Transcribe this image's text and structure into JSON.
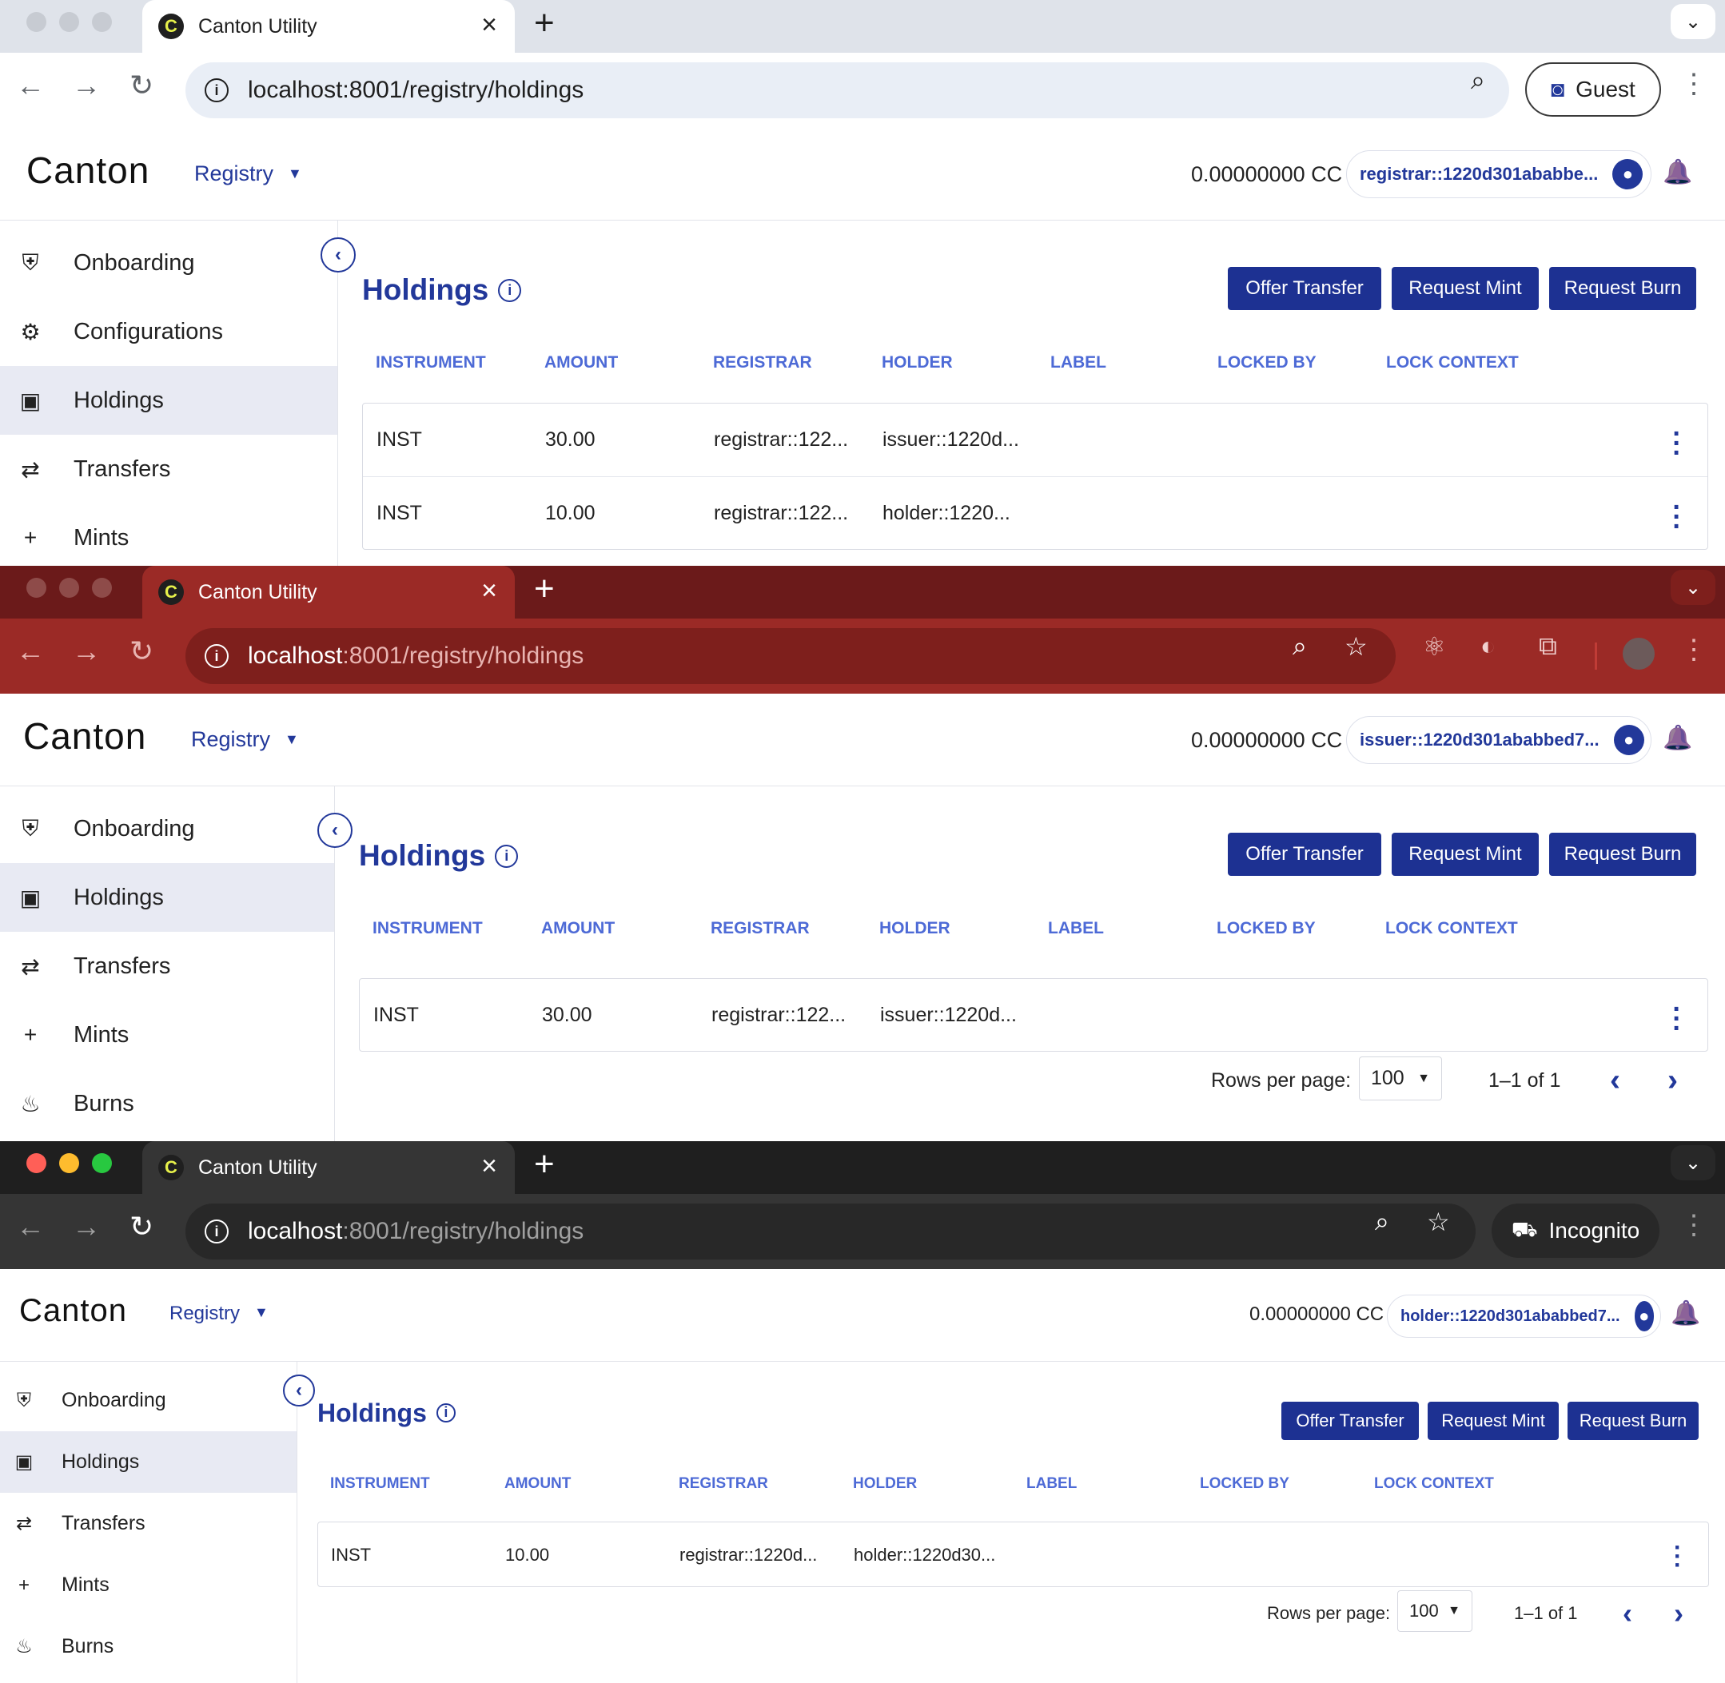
{
  "windows": [
    {
      "theme": "light",
      "tab_title": "Canton Utility",
      "url_host": "localhost",
      "url_path": ":8001/registry/holdings",
      "profile_label": "Guest",
      "app": {
        "logo": "Canton",
        "menu_label": "Registry",
        "balance": "0.00000000 CC",
        "party": "registrar::1220d301ababbe...",
        "sidebar": [
          {
            "icon": "shield-icon",
            "label": "Onboarding",
            "active": false
          },
          {
            "icon": "gear-icon",
            "label": "Configurations",
            "active": false
          },
          {
            "icon": "wallet-icon",
            "label": "Holdings",
            "active": true
          },
          {
            "icon": "transfer-icon",
            "label": "Transfers",
            "active": false
          },
          {
            "icon": "plus-icon",
            "label": "Mints",
            "active": false
          }
        ],
        "page_title": "Holdings",
        "buttons": {
          "offer": "Offer Transfer",
          "mint": "Request Mint",
          "burn": "Request Burn"
        },
        "columns": [
          "INSTRUMENT",
          "AMOUNT",
          "REGISTRAR",
          "HOLDER",
          "LABEL",
          "LOCKED BY",
          "LOCK CONTEXT"
        ],
        "rows": [
          [
            "INST",
            "30.00",
            "registrar::122...",
            "issuer::1220d...",
            "",
            "",
            ""
          ],
          [
            "INST",
            "10.00",
            "registrar::122...",
            "holder::1220...",
            "",
            "",
            ""
          ]
        ]
      }
    },
    {
      "theme": "red",
      "tab_title": "Canton Utility",
      "url_host": "localhost",
      "url_path": ":8001/registry/holdings",
      "app": {
        "logo": "Canton",
        "menu_label": "Registry",
        "balance": "0.00000000 CC",
        "party": "issuer::1220d301ababbed7...",
        "sidebar": [
          {
            "icon": "shield-icon",
            "label": "Onboarding",
            "active": false
          },
          {
            "icon": "wallet-icon",
            "label": "Holdings",
            "active": true
          },
          {
            "icon": "transfer-icon",
            "label": "Transfers",
            "active": false
          },
          {
            "icon": "plus-icon",
            "label": "Mints",
            "active": false
          },
          {
            "icon": "fire-icon",
            "label": "Burns",
            "active": false
          }
        ],
        "page_title": "Holdings",
        "buttons": {
          "offer": "Offer Transfer",
          "mint": "Request Mint",
          "burn": "Request Burn"
        },
        "columns": [
          "INSTRUMENT",
          "AMOUNT",
          "REGISTRAR",
          "HOLDER",
          "LABEL",
          "LOCKED BY",
          "LOCK CONTEXT"
        ],
        "rows": [
          [
            "INST",
            "30.00",
            "registrar::122...",
            "issuer::1220d...",
            "",
            "",
            ""
          ]
        ],
        "pagination": {
          "rows_per_page_label": "Rows per page:",
          "rows_per_page": "100",
          "range": "1–1 of 1"
        }
      }
    },
    {
      "theme": "dark",
      "tab_title": "Canton Utility",
      "url_host": "localhost",
      "url_path": ":8001/registry/holdings",
      "profile_label": "Incognito",
      "app": {
        "logo": "Canton",
        "menu_label": "Registry",
        "balance": "0.00000000 CC",
        "party": "holder::1220d301ababbed7...",
        "sidebar": [
          {
            "icon": "shield-icon",
            "label": "Onboarding",
            "active": false
          },
          {
            "icon": "wallet-icon",
            "label": "Holdings",
            "active": true
          },
          {
            "icon": "transfer-icon",
            "label": "Transfers",
            "active": false
          },
          {
            "icon": "plus-icon",
            "label": "Mints",
            "active": false
          },
          {
            "icon": "fire-icon",
            "label": "Burns",
            "active": false
          }
        ],
        "page_title": "Holdings",
        "buttons": {
          "offer": "Offer Transfer",
          "mint": "Request Mint",
          "burn": "Request Burn"
        },
        "columns": [
          "INSTRUMENT",
          "AMOUNT",
          "REGISTRAR",
          "HOLDER",
          "LABEL",
          "LOCKED BY",
          "LOCK CONTEXT"
        ],
        "rows": [
          [
            "INST",
            "10.00",
            "registrar::1220d...",
            "holder::1220d30...",
            "",
            "",
            ""
          ]
        ],
        "pagination": {
          "rows_per_page_label": "Rows per page:",
          "rows_per_page": "100",
          "range": "1–1 of 1"
        }
      }
    }
  ],
  "themes": {
    "light": {
      "strip": "#dfe3ea",
      "tab": "#ffffff",
      "toolbar": "#ffffff",
      "omni": "#e9eef6",
      "text": "#1f1f1f",
      "muted": "#5f6368",
      "accent": "#1f1f1f"
    },
    "red": {
      "strip": "#6b1a1a",
      "tab": "#9b2a26",
      "toolbar": "#9b2a26",
      "omni": "#7e1f1c",
      "text": "#ffffff",
      "muted": "#e8b4b1",
      "accent": "#ffffff"
    },
    "dark": {
      "strip": "#1f1f1f",
      "tab": "#353535",
      "toolbar": "#353535",
      "omni": "#282828",
      "text": "#ffffff",
      "muted": "#a0a0a0",
      "accent": "#ffffff"
    }
  },
  "icon_glyphs": {
    "shield-icon": "⛨",
    "gear-icon": "⚙",
    "wallet-icon": "▣",
    "transfer-icon": "⇄",
    "plus-icon": "+",
    "fire-icon": "♨"
  }
}
